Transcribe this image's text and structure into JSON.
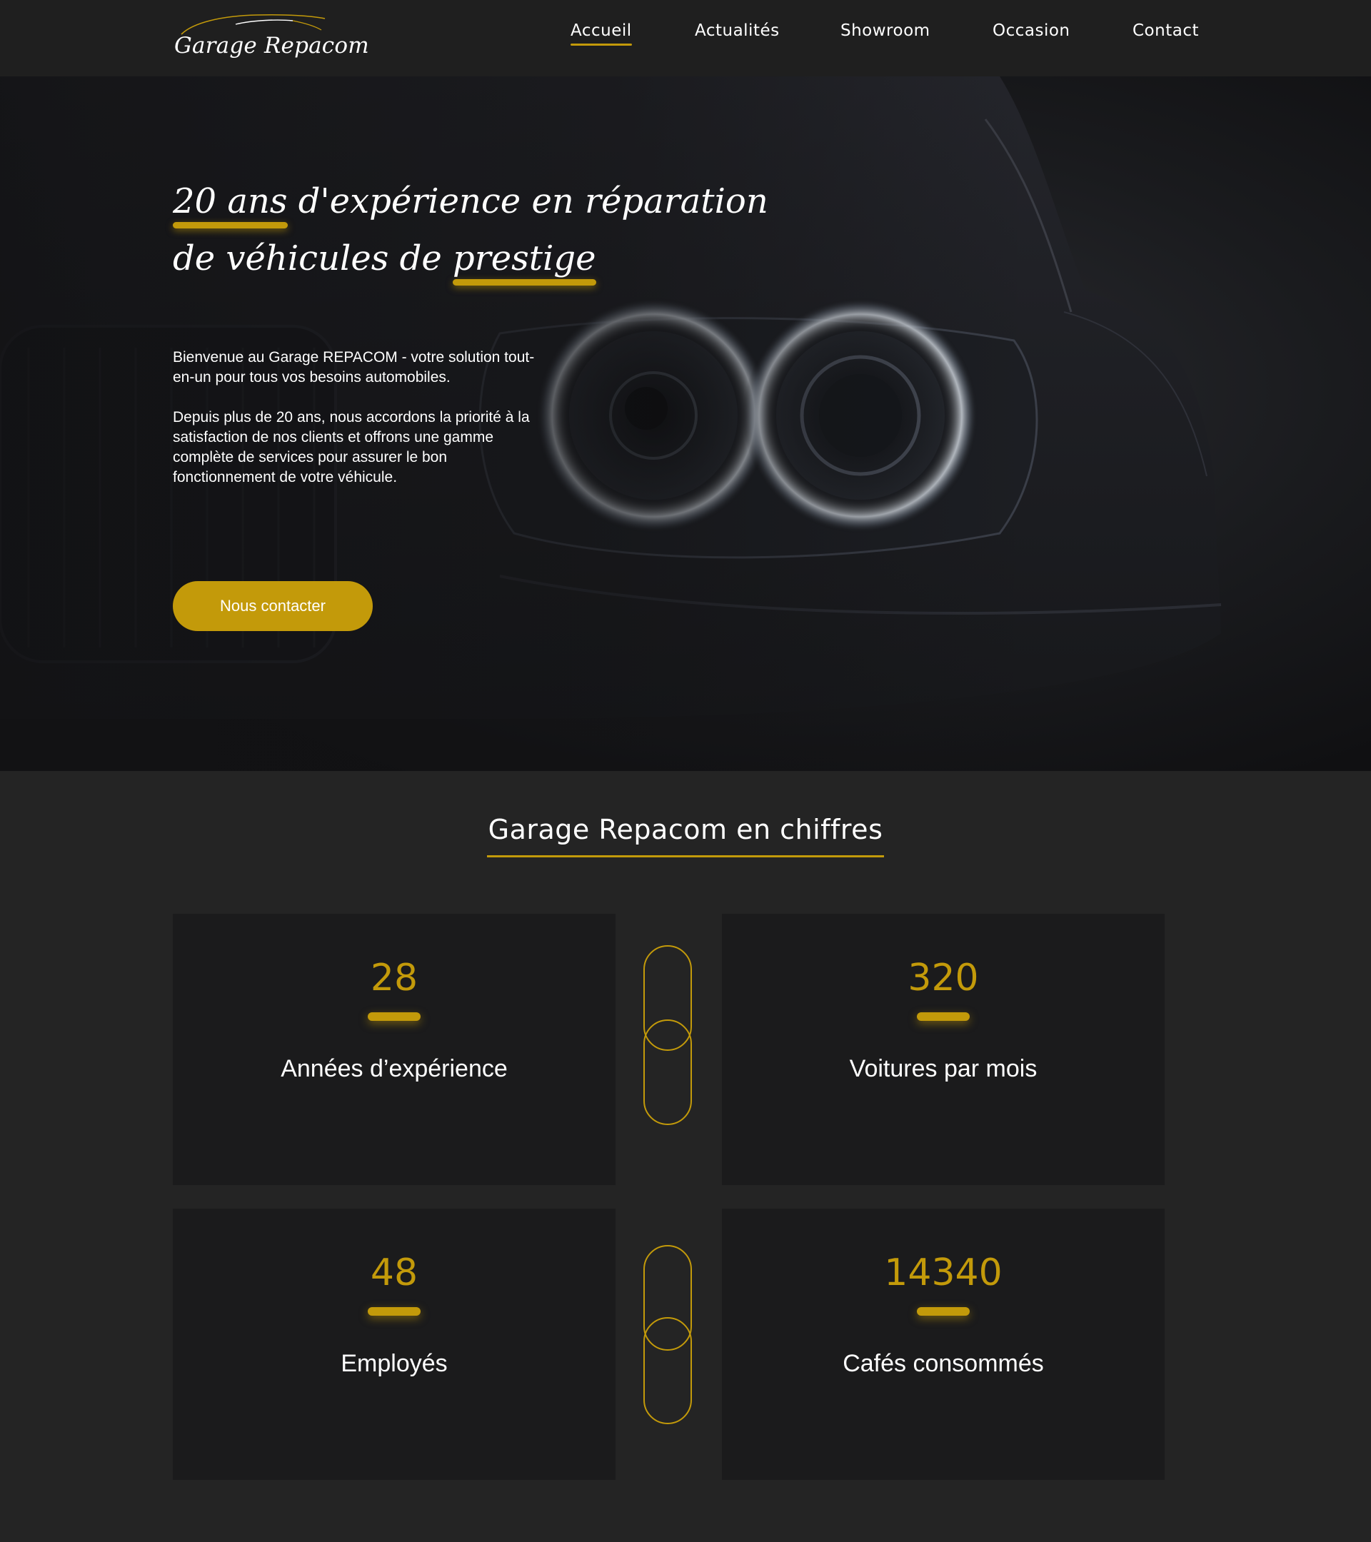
{
  "header": {
    "logo_text": "Garage Repacom",
    "nav": [
      {
        "label": "Accueil",
        "active": true
      },
      {
        "label": "Actualités",
        "active": false
      },
      {
        "label": "Showroom",
        "active": false
      },
      {
        "label": "Occasion",
        "active": false
      },
      {
        "label": "Contact",
        "active": false
      }
    ]
  },
  "hero": {
    "title_line1_highlight": "20 ans",
    "title_line1_rest": " d'expérience en réparation",
    "title_line2_start": "de véhicules de ",
    "title_line2_highlight": "prestige",
    "paragraph1": "Bienvenue au Garage REPACOM - votre solution tout-en-un pour tous vos besoins automobiles.",
    "paragraph2": "Depuis plus de 20 ans, nous accordons la priorité à la satisfaction de nos  clients et offrons une gamme complète de services pour assurer le bon fonctionnement de votre véhicule.",
    "cta_label": "Nous contacter"
  },
  "stats": {
    "title": "Garage Repacom en chiffres",
    "cards": [
      {
        "number": "28",
        "label": "Années d’expérience"
      },
      {
        "number": "320",
        "label": "Voitures par mois"
      },
      {
        "number": "48",
        "label": "Employés"
      },
      {
        "number": "14340",
        "label": "Cafés consommés"
      }
    ]
  },
  "colors": {
    "accent": "#c39a0a",
    "header_bg": "#1f1f1f",
    "page_bg": "#242424",
    "card_bg": "#1b1b1c"
  }
}
